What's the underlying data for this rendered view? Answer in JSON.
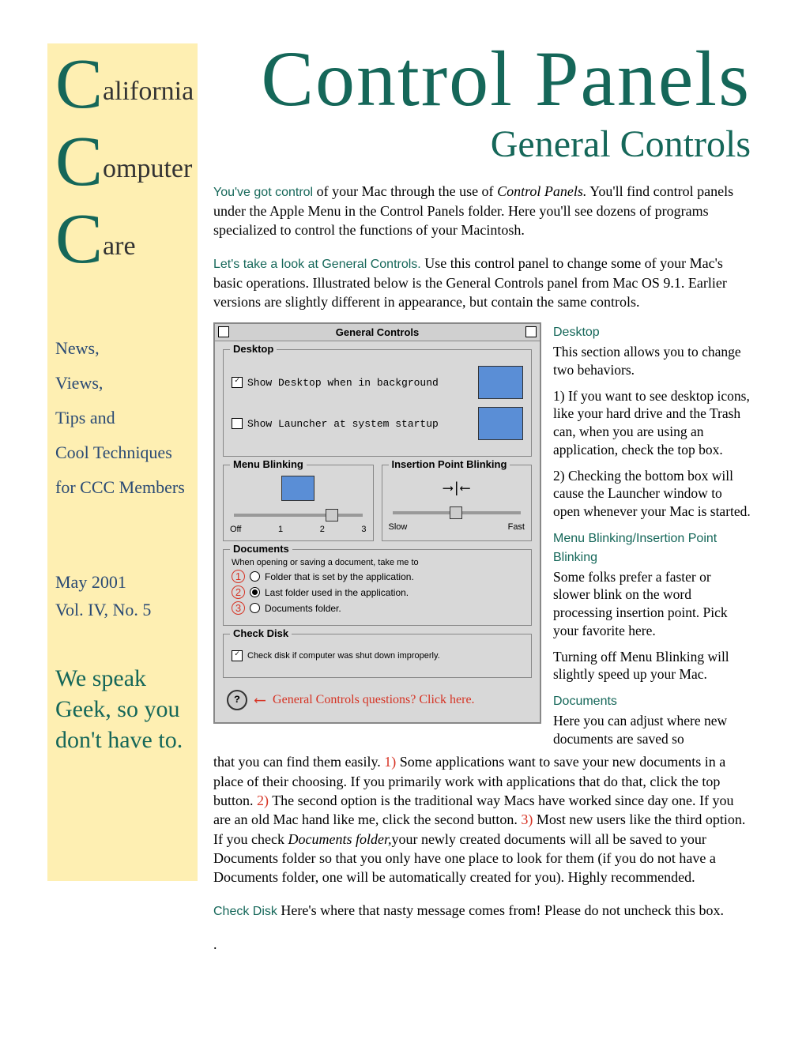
{
  "sidebar": {
    "logo": {
      "c": "C",
      "w1": "alifornia",
      "w2": "omputer",
      "w3": "are"
    },
    "tagline": {
      "l1": "News,",
      "l2": "Views,",
      "l3": "Tips and",
      "l4": "Cool Techniques",
      "l5": "for CCC Members"
    },
    "date": {
      "l1": "May 2001",
      "l2": "Vol. IV, No. 5"
    },
    "motto": "We speak Geek, so you don't have to."
  },
  "headline": "Control Panels",
  "subheadline": "General Controls",
  "intro1_lead": "You've got control",
  "intro1_rest": " of your Mac through the use of ",
  "intro1_italic": "Control Panels.",
  "intro1_tail": " You'll find control panels under the Apple Menu in the Control Panels folder. Here you'll see dozens of programs specialized to control the functions of your Macintosh.",
  "intro2_lead": "Let's take a look at General Controls.",
  "intro2_rest": " Use this control panel to change some of your Mac's basic operations. Illustrated below is the General Controls panel from Mac OS 9.1. Earlier versions are slightly different in appearance, but contain the same controls.",
  "panel": {
    "title": "General Controls",
    "desktop_label": "Desktop",
    "cb1": "Show Desktop when in background",
    "cb2": "Show Launcher at system startup",
    "menublink_label": "Menu Blinking",
    "insertion_label": "Insertion Point Blinking",
    "slider1": {
      "l1": "Off",
      "l2": "1",
      "l3": "2",
      "l4": "3"
    },
    "slider2": {
      "l1": "Slow",
      "l2": "Fast"
    },
    "docs_label": "Documents",
    "docs_intro": "When opening or saving a document, take me to",
    "r1": "Folder that is set by the application.",
    "r2": "Last folder used in the application.",
    "r3": "Documents folder.",
    "checkdisk_label": "Check Disk",
    "checkdisk_cb": "Check disk if computer was shut down improperly.",
    "help_text": "General Controls questions? Click here."
  },
  "right": {
    "desktop_head": "Desktop",
    "desktop_p1": "This section allows you to change two behaviors.",
    "desktop_p2": "1)  If you want to see desktop icons, like your hard drive and the Trash can, when you are using an application, check the top box.",
    "desktop_p3": "2)  Checking the bottom box will cause the Launcher window to open whenever your Mac is started.",
    "blink_head": "Menu Blinking/Insertion Point Blinking",
    "blink_p1": "Some folks prefer a faster or slower blink on the word processing insertion point. Pick your favorite here.",
    "blink_p2": "Turning off Menu Blinking will slightly speed up your Mac.",
    "docs_head": "Documents",
    "docs_p1": "Here you can adjust where new documents are saved so"
  },
  "below": {
    "part1": "that you can find them easily. ",
    "n1": "1)",
    "part2": "  Some applications want to save your new documents in a place of their choosing. If you primarily work with applications that do that, click the top button. ",
    "n2": "2)",
    "part3": "  The second option is the traditional way Macs have worked since day one. If you are an old Mac hand like me, click the second button. ",
    "n3": "3)",
    "part4": "  Most new users like the third option. If you check ",
    "italic": "Documents folder,",
    "part5": "your newly created documents will all be saved to your Documents folder so that you only have one place to look for them (if you do not have a Documents folder, one will be automatically created for you). Highly recommended.",
    "checkdisk_head": "Check Disk",
    "checkdisk_text": "   Here's where that nasty message comes from! Please do not uncheck this box."
  }
}
